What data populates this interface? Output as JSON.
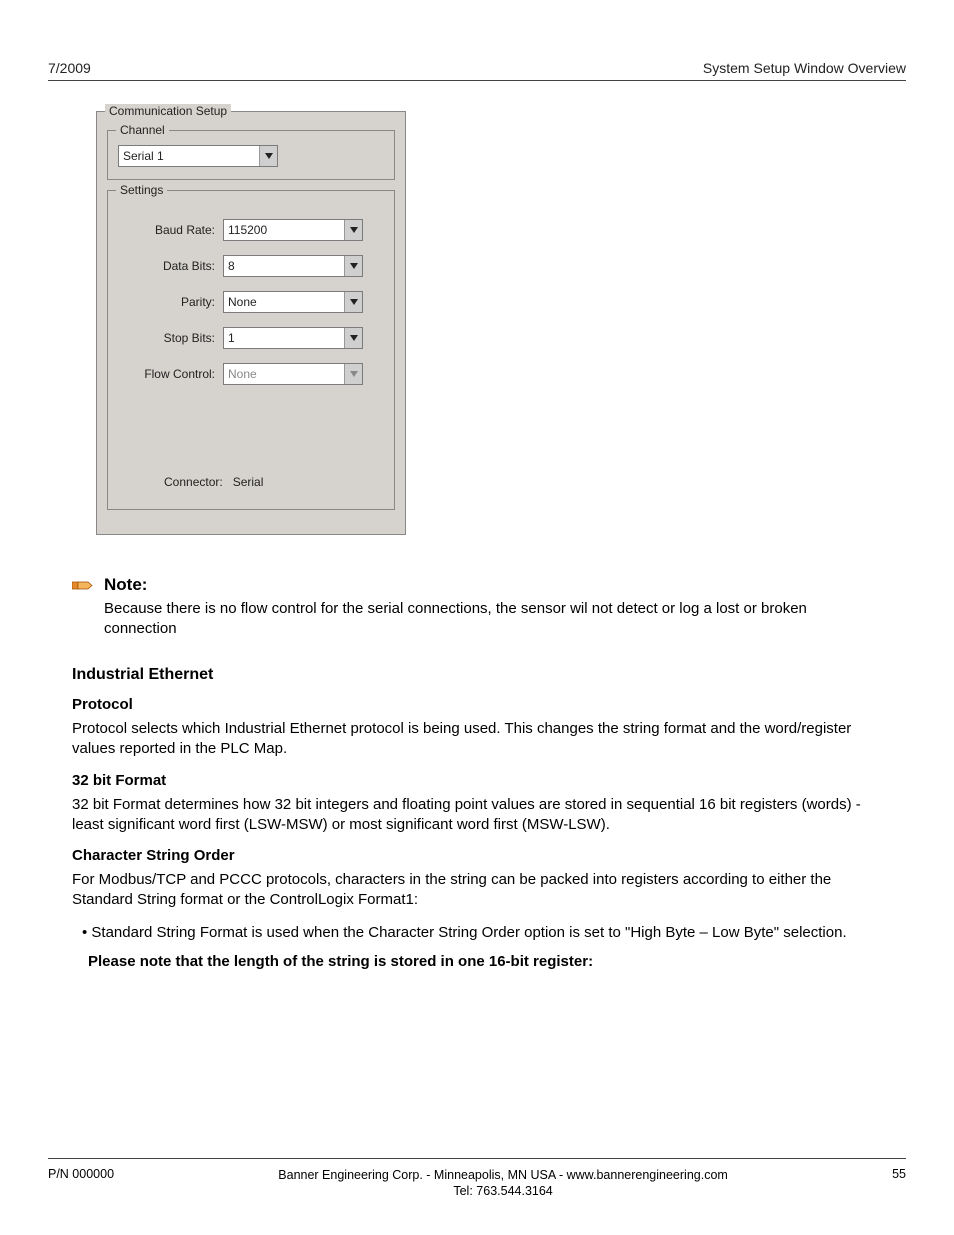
{
  "header": {
    "left": "7/2009",
    "right": "System Setup Window Overview"
  },
  "panel": {
    "group_label": "Communication Setup",
    "channel": {
      "label": "Channel",
      "value": "Serial 1"
    },
    "settings": {
      "label": "Settings",
      "fields": {
        "baud": {
          "label": "Baud Rate:",
          "value": "115200",
          "enabled": true
        },
        "databits": {
          "label": "Data Bits:",
          "value": "8",
          "enabled": true
        },
        "parity": {
          "label": "Parity:",
          "value": "None",
          "enabled": true
        },
        "stopbits": {
          "label": "Stop Bits:",
          "value": "1",
          "enabled": true
        },
        "flow": {
          "label": "Flow Control:",
          "value": "None",
          "enabled": false
        }
      },
      "connector": {
        "label": "Connector:",
        "value": "Serial"
      }
    }
  },
  "note": {
    "heading": "Note:",
    "body": "Because there is no flow control for the serial connections, the sensor wil not detect or log a lost or broken connection"
  },
  "ethernet": {
    "heading": "Industrial Ethernet",
    "protocol": {
      "heading": "Protocol",
      "body": "Protocol selects which Industrial Ethernet protocol is being used. This changes the string format and the word/register values reported in the PLC Map."
    },
    "format32": {
      "heading": "32 bit Format",
      "body": "32 bit Format determines how 32 bit integers and floating point values are stored in sequential 16 bit registers (words) - least significant word first (LSW-MSW) or most significant word first (MSW-LSW)."
    },
    "charorder": {
      "heading": "Character String Order",
      "body": "For Modbus/TCP and PCCC protocols, characters in the string can be packed into registers according to either the Standard String format or the ControlLogix Format1:",
      "bullet": "Standard String Format is used when the Character String Order option is set to \"High Byte – Low Byte\" selection.",
      "boldnote": "Please note that the length of the string is stored in one 16-bit register:"
    }
  },
  "footer": {
    "left": "P/N 000000",
    "center1": "Banner Engineering Corp. - Minneapolis, MN USA - www.bannerengineering.com",
    "center2": "Tel: 763.544.3164",
    "right": "55"
  }
}
